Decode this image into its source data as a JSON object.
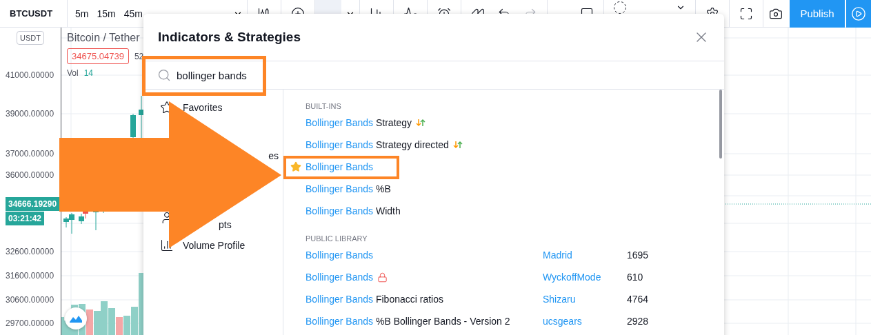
{
  "toolbar": {
    "symbol": "BTCUSDT",
    "intervals": [
      {
        "label": "5m",
        "selected": false
      },
      {
        "label": "15m",
        "selected": false
      },
      {
        "label": "45m",
        "selected": false
      }
    ],
    "publish": "Publish"
  },
  "chart": {
    "unit": "USDT",
    "ticks": [
      "41000.00000",
      "39000.00000",
      "37000.00000",
      "36000.00000",
      "32600.00000",
      "31600.00000",
      "30600.00000",
      "29700.00000"
    ],
    "price_tag": "34666.19290",
    "countdown": "03:21:42",
    "legend": {
      "title": "Bitcoin / Tether",
      "price": "34675.04739",
      "price_cut": "52",
      "volume_label": "Vol",
      "volume_value": "14"
    }
  },
  "dialog": {
    "title": "Indicators & Strategies",
    "search": {
      "value": "bollinger bands",
      "highlighted": true
    },
    "sidebar": [
      {
        "kind": "favorites",
        "label": "Favorites"
      },
      {
        "kind": "covered"
      },
      {
        "kind": "tail",
        "label": "es"
      },
      {
        "kind": "covered"
      },
      {
        "kind": "clipped",
        "label": "pts"
      },
      {
        "kind": "profile",
        "label": "Volume Profile"
      }
    ],
    "sections": [
      {
        "heading": "BUILT-INS",
        "items": [
          {
            "name": "Bollinger Bands",
            "suffix": "Strategy",
            "strategy": true,
            "favorite": false,
            "highlighted": false
          },
          {
            "name": "Bollinger Bands",
            "suffix": "Strategy directed",
            "strategy": true,
            "favorite": false,
            "highlighted": false
          },
          {
            "name": "Bollinger Bands",
            "strategy": false,
            "favorite": true,
            "highlighted": true
          },
          {
            "name": "Bollinger Bands",
            "suffix": "%B",
            "strategy": false,
            "favorite": false,
            "highlighted": false
          },
          {
            "name": "Bollinger Bands",
            "suffix": "Width",
            "strategy": false,
            "favorite": false,
            "highlighted": false
          }
        ]
      },
      {
        "heading": "PUBLIC LIBRARY",
        "items": [
          {
            "name": "Bollinger Bands",
            "locked": false,
            "author": "Madrid",
            "count": "1695"
          },
          {
            "name": "Bollinger Bands",
            "locked": true,
            "author": "WyckoffMode",
            "count": "610"
          },
          {
            "name": "Bollinger Bands",
            "suffix": "Fibonacci ratios",
            "locked": false,
            "author": "Shizaru",
            "count": "4764"
          },
          {
            "name": "Bollinger Bands",
            "suffix": "%B Bollinger Bands - Version 2",
            "locked": false,
            "author": "ucsgears",
            "count": "2928"
          }
        ]
      }
    ]
  }
}
